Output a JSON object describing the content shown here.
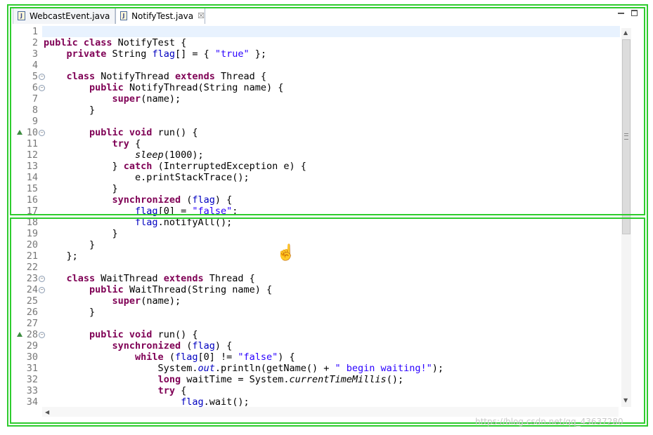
{
  "tabs": [
    {
      "label": "WebcastEvent.java",
      "icon": "java-file-icon"
    },
    {
      "label": "NotifyTest.java",
      "icon": "java-file-icon",
      "close": "☒"
    }
  ],
  "code": [
    {
      "n": "1",
      "t": ""
    },
    {
      "n": "2",
      "t": "<span class='kw'>public class</span> NotifyTest {"
    },
    {
      "n": "3",
      "t": "    <span class='kw'>private</span> String <span class='fld'>flag</span>[] = { <span class='str'>\"true\"</span> };"
    },
    {
      "n": "4",
      "t": ""
    },
    {
      "n": "5",
      "t": "    <span class='kw'>class</span> NotifyThread <span class='kw'>extends</span> Thread {",
      "fold": true
    },
    {
      "n": "6",
      "t": "        <span class='kw'>public</span> NotifyThread(String name) {",
      "fold": true
    },
    {
      "n": "7",
      "t": "            <span class='kw'>super</span>(name);"
    },
    {
      "n": "8",
      "t": "        }"
    },
    {
      "n": "9",
      "t": ""
    },
    {
      "n": "10",
      "t": "        <span class='kw'>public void</span> run() {",
      "fold": true,
      "override": true
    },
    {
      "n": "11",
      "t": "            <span class='kw'>try</span> {"
    },
    {
      "n": "12",
      "t": "                <span class='ital'>sleep</span>(1000);"
    },
    {
      "n": "13",
      "t": "            } <span class='kw'>catch</span> (InterruptedException e) {"
    },
    {
      "n": "14",
      "t": "                e.printStackTrace();"
    },
    {
      "n": "15",
      "t": "            }"
    },
    {
      "n": "16",
      "t": "            <span class='kw'>synchronized</span> (<span class='fld'>flag</span>) {"
    },
    {
      "n": "17",
      "t": "                <span class='fld'>flag</span>[0] = <span class='str'>\"false\"</span>;"
    },
    {
      "n": "18",
      "t": "                <span class='fld'>flag</span>.notifyAll();"
    },
    {
      "n": "19",
      "t": "            }"
    },
    {
      "n": "20",
      "t": "        }"
    },
    {
      "n": "21",
      "t": "    };"
    },
    {
      "n": "22",
      "t": ""
    },
    {
      "n": "23",
      "t": "    <span class='kw'>class</span> WaitThread <span class='kw'>extends</span> Thread {",
      "fold": true
    },
    {
      "n": "24",
      "t": "        <span class='kw'>public</span> WaitThread(String name) {",
      "fold": true
    },
    {
      "n": "25",
      "t": "            <span class='kw'>super</span>(name);"
    },
    {
      "n": "26",
      "t": "        }"
    },
    {
      "n": "27",
      "t": ""
    },
    {
      "n": "28",
      "t": "        <span class='kw'>public void</span> run() {",
      "fold": true,
      "override": true
    },
    {
      "n": "29",
      "t": "            <span class='kw'>synchronized</span> (<span class='fld'>flag</span>) {"
    },
    {
      "n": "30",
      "t": "                <span class='kw'>while</span> (<span class='fld'>flag</span>[0] != <span class='str'>\"false\"</span>) {"
    },
    {
      "n": "31",
      "t": "                    System.<span class='fld ital'>out</span>.println(getName() + <span class='str'>\" begin waiting!\"</span>);"
    },
    {
      "n": "32",
      "t": "                    <span class='kw'>long</span> waitTime = System.<span class='ital'>currentTimeMillis</span>();"
    },
    {
      "n": "33",
      "t": "                    <span class='kw'>try</span> {"
    },
    {
      "n": "34",
      "t": "                        <span class='fld'>flag</span>.wait();"
    }
  ],
  "watermark": "https://blog.csdn.net/qq_43637280",
  "colors": {
    "highlight_box": "#2ecc2e",
    "keyword": "#7f0055",
    "field": "#0000c0",
    "string": "#2a00ff"
  }
}
